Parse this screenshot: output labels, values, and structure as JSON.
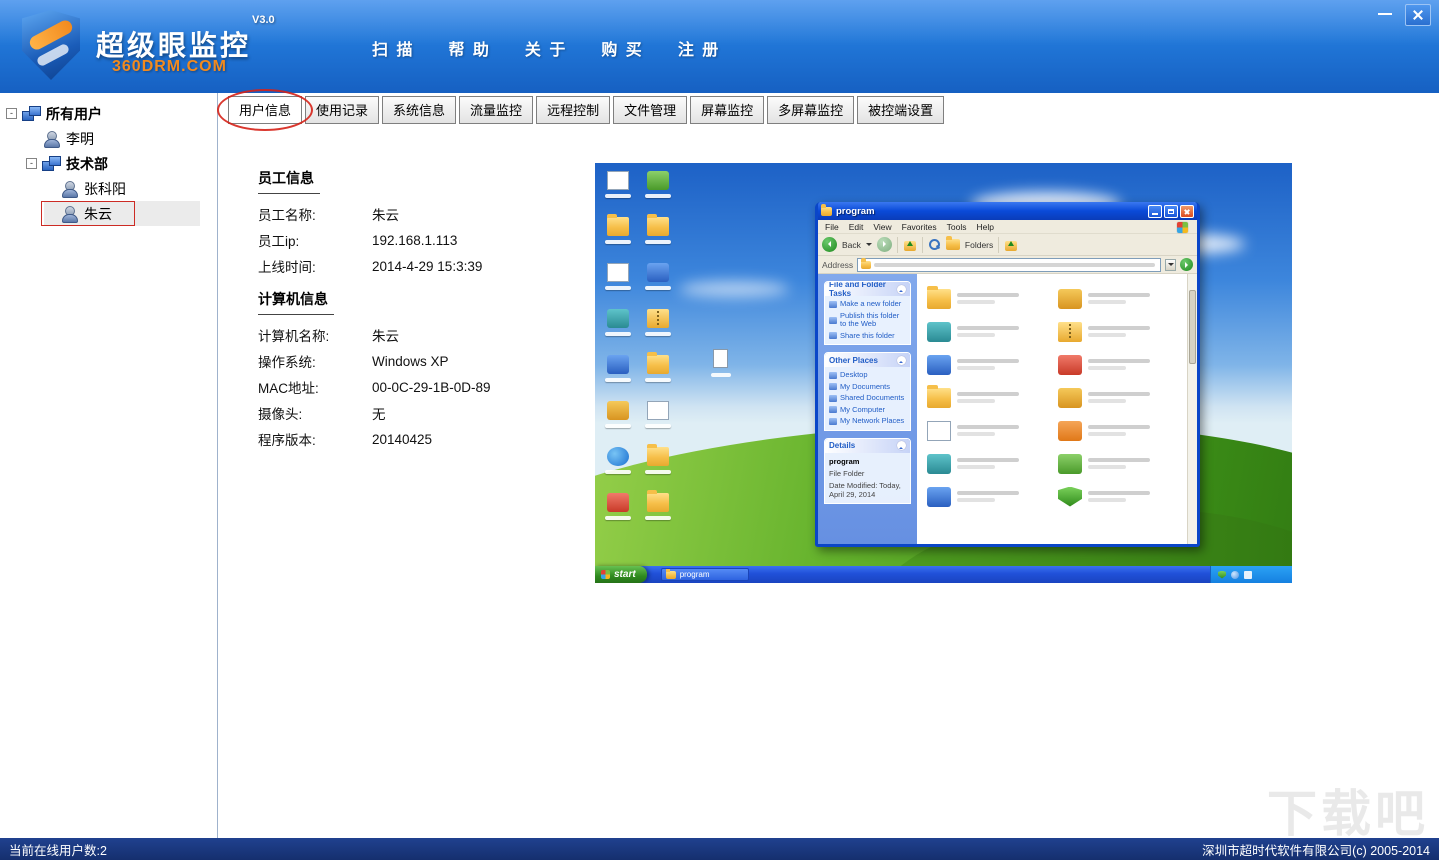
{
  "header": {
    "app_title": "超级眼监控",
    "version": "V3.0",
    "website": "360DRM.COM",
    "menu": [
      {
        "label": "扫 描"
      },
      {
        "label": "帮 助"
      },
      {
        "label": "关 于"
      },
      {
        "label": "购 买"
      },
      {
        "label": "注 册"
      }
    ]
  },
  "icons": {
    "window_controls": [
      "minimize-icon",
      "close-icon"
    ],
    "tree": [
      "group-computers-icon",
      "user-icon",
      "expander-minus-icon"
    ],
    "annotations": [
      "red-ellipse-annotation",
      "red-box-annotation"
    ]
  },
  "tree": {
    "items": [
      {
        "label": "所有用户",
        "cls": "group d0",
        "toggle": "-"
      },
      {
        "label": "李明",
        "cls": "user d1"
      },
      {
        "label": "技术部",
        "cls": "group d1",
        "toggle": "-"
      },
      {
        "label": "张科阳",
        "cls": "user d2"
      },
      {
        "label": "朱云",
        "cls": "user d2 selected"
      }
    ]
  },
  "tabs": [
    {
      "label": "用户信息",
      "cls": "active"
    },
    {
      "label": "使用记录"
    },
    {
      "label": "系统信息"
    },
    {
      "label": "流量监控"
    },
    {
      "label": "远程控制"
    },
    {
      "label": "文件管理"
    },
    {
      "label": "屏幕监控"
    },
    {
      "label": "多屏幕监控"
    },
    {
      "label": "被控端设置"
    }
  ],
  "employee_info": {
    "title": "员工信息",
    "rows": [
      {
        "label": "员工名称:",
        "value": "朱云"
      },
      {
        "label": "员工ip:",
        "value": "192.168.1.113"
      },
      {
        "label": "上线时间:",
        "value": "2014-4-29 15:3:39"
      }
    ]
  },
  "computer_info": {
    "title": "计算机信息",
    "rows": [
      {
        "label": "计算机名称:",
        "value": "朱云"
      },
      {
        "label": "操作系统:",
        "value": "Windows XP"
      },
      {
        "label": "MAC地址:",
        "value": "00-0C-29-1B-0D-89"
      },
      {
        "label": "摄像头:",
        "value": "无"
      },
      {
        "label": "程序版本:",
        "value": "20140425"
      }
    ]
  },
  "remote_screen": {
    "desktop_icons": [
      {
        "icon": "doc"
      },
      {
        "icon": "folder"
      },
      {
        "icon": "doc"
      },
      {
        "icon": "app-teal"
      },
      {
        "icon": "app-blue"
      },
      {
        "icon": "app-gold"
      },
      {
        "icon": "ie"
      },
      {
        "icon": "app-red"
      },
      {
        "icon": "app-green"
      },
      {
        "icon": "folder"
      },
      {
        "icon": "app-blue"
      },
      {
        "icon": "zip"
      },
      {
        "icon": "folder"
      },
      {
        "icon": "doc"
      },
      {
        "icon": "folder"
      },
      {
        "icon": "folder"
      }
    ],
    "explorer": {
      "title": "program",
      "menu": [
        "File",
        "Edit",
        "View",
        "Favorites",
        "Tools",
        "Help"
      ],
      "toolbar": {
        "back": "Back",
        "folders": "Folders"
      },
      "address_label": "Address",
      "panels": {
        "tasks": {
          "title": "File and Folder Tasks",
          "items": [
            "Make a new folder",
            "Publish this folder to the Web",
            "Share this folder"
          ]
        },
        "places": {
          "title": "Other Places",
          "items": [
            "Desktop",
            "My Documents",
            "Shared Documents",
            "My Computer",
            "My Network Places"
          ]
        },
        "details": {
          "title": "Details",
          "name": "program",
          "type": "File Folder",
          "date": "Date Modified: Today, April 29, 2014"
        }
      },
      "files": [
        {
          "icon": "folder"
        },
        {
          "icon": "app-gold"
        },
        {
          "icon": "app-teal"
        },
        {
          "icon": "zip"
        },
        {
          "icon": "app-blue"
        },
        {
          "icon": "app-red"
        },
        {
          "icon": "folder"
        },
        {
          "icon": "app-gold"
        },
        {
          "icon": "doc"
        },
        {
          "icon": "app-orange"
        },
        {
          "icon": "app-teal"
        },
        {
          "icon": "app-green"
        },
        {
          "icon": "app-blue"
        },
        {
          "icon": "shield"
        }
      ]
    },
    "taskbar": {
      "start": "start",
      "task": "program"
    }
  },
  "statusbar": {
    "left": "当前在线用户数:2",
    "right": "深圳市超时代软件有限公司(c) 2005-2014"
  },
  "watermark": "下载吧",
  "colors": {
    "header_blue": "#2177d8",
    "accent_orange": "#f28a1e",
    "status_navy": "#17337c",
    "annotation_red": "#d42a1e"
  }
}
